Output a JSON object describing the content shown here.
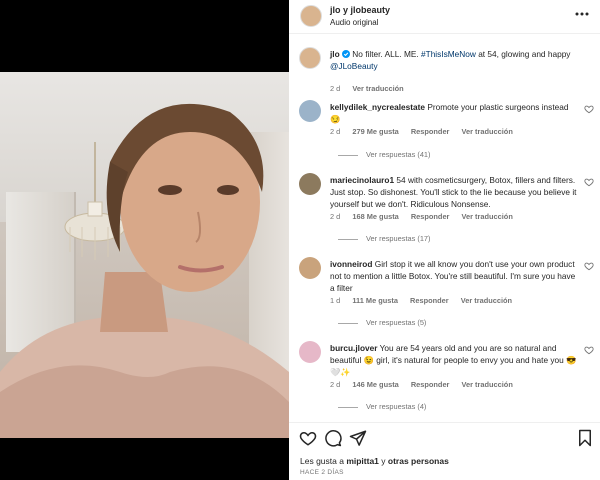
{
  "header": {
    "username_line": "jlo y jlobeauty",
    "audio": "Audio original",
    "more_icon": "more-horizontal-icon"
  },
  "caption": {
    "username": "jlo",
    "verified_icon": "verified-badge-icon",
    "text_before": " No filter. ALL. ME. ",
    "hashtag": "#ThisIsMeNow",
    "text_middle": " at 54, glowing and happy ",
    "mention": "@JLoBeauty",
    "time": "2 d",
    "translate": "Ver traducción"
  },
  "comments": [
    {
      "username": "kellydilek_nycrealestate",
      "text": "Promote your plastic surgeons instead 😏",
      "time": "2 d",
      "likes": "279 Me gusta",
      "reply": "Responder",
      "translate": "Ver traducción",
      "replies": "Ver respuestas (41)",
      "avatar_color": "#9bb3c9"
    },
    {
      "username": "mariecinolauro1",
      "text": "54 with cosmeticsurgery, Botox, fillers and filters. Just stop. So dishonest. You'll stick to the lie because you believe it yourself but we don't. Ridiculous Nonsense.",
      "time": "2 d",
      "likes": "168 Me gusta",
      "reply": "Responder",
      "translate": "Ver traducción",
      "replies": "Ver respuestas (17)",
      "avatar_color": "#8c7a5e"
    },
    {
      "username": "ivonneirod",
      "text": "Girl stop it we all know you don't use your own product not to mention a little Botox. You're still beautiful. I'm sure you have a filter",
      "time": "1 d",
      "likes": "111 Me gusta",
      "reply": "Responder",
      "translate": "Ver traducción",
      "replies": "Ver respuestas (5)",
      "avatar_color": "#c9a37c"
    },
    {
      "username": "burcu.jlover",
      "text": "You are 54 years old and you are so natural and beautiful 😉 girl, it's natural for people to envy you and hate you 😎🤍✨",
      "time": "2 d",
      "likes": "146 Me gusta",
      "reply": "Responder",
      "translate": "Ver traducción",
      "replies": "Ver respuestas (4)",
      "avatar_color": "#e6b8c8"
    }
  ],
  "actions": {
    "like_icon": "heart-icon",
    "comment_icon": "comment-icon",
    "share_icon": "send-icon",
    "save_icon": "bookmark-icon",
    "likes_prefix": "Les gusta a ",
    "likes_user": "mipitta1",
    "likes_suffix": " y ",
    "likes_others": "otras personas",
    "date": "HACE 2 DÍAS"
  },
  "colors": {
    "link": "#00376b",
    "verified": "#0095f6",
    "muted": "#737373"
  }
}
